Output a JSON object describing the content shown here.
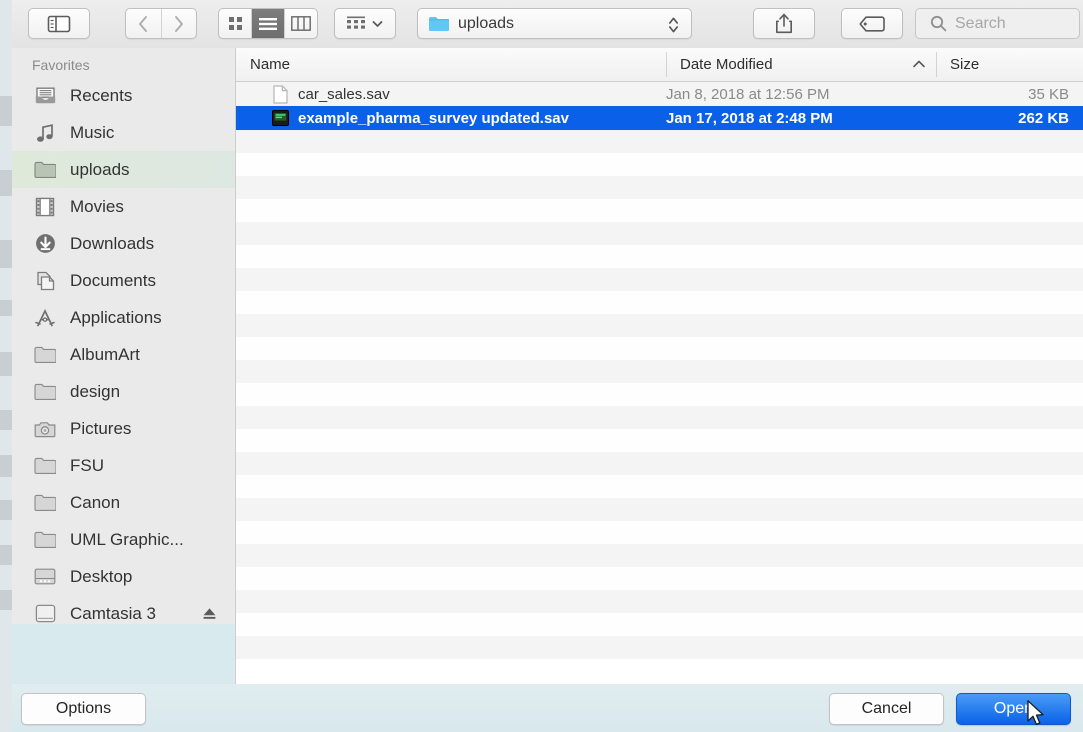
{
  "toolbar": {
    "sidebar_toggle_icon": "sidebar-toggle-icon",
    "back_icon": "chevron-left-icon",
    "forward_icon": "chevron-right-icon",
    "view_icon_grid": "grid-view-icon",
    "view_icon_list": "list-view-icon",
    "view_icon_column": "column-view-icon",
    "arrange_icon": "arrange-by-icon",
    "arrange_chevron": "chevron-down-icon",
    "path_label": "uploads",
    "path_folder_icon": "folder-icon",
    "path_stepper_icon": "chevron-up-down-icon",
    "share_icon": "share-icon",
    "tag_icon": "tag-icon",
    "search_icon": "search-icon",
    "search_placeholder": "Search",
    "search_value": ""
  },
  "sidebar": {
    "heading": "Favorites",
    "items": [
      {
        "label": "Recents",
        "icon": "recents-inbox-icon",
        "state": "normal"
      },
      {
        "label": "Music",
        "icon": "music-note-icon",
        "state": "normal"
      },
      {
        "label": "uploads",
        "icon": "folder-icon",
        "state": "selected"
      },
      {
        "label": "Movies",
        "icon": "film-strip-icon",
        "state": "normal"
      },
      {
        "label": "Downloads",
        "icon": "download-arrow-icon",
        "state": "normal"
      },
      {
        "label": "Documents",
        "icon": "documents-pages-icon",
        "state": "normal"
      },
      {
        "label": "Applications",
        "icon": "applications-a-icon",
        "state": "normal"
      },
      {
        "label": "AlbumArt",
        "icon": "folder-icon",
        "state": "normal"
      },
      {
        "label": "design",
        "icon": "folder-icon",
        "state": "normal"
      },
      {
        "label": "Pictures",
        "icon": "camera-icon",
        "state": "normal"
      },
      {
        "label": "FSU",
        "icon": "folder-icon",
        "state": "normal"
      },
      {
        "label": "Canon",
        "icon": "folder-icon",
        "state": "normal"
      },
      {
        "label": "UML Graphic...",
        "icon": "folder-icon",
        "state": "normal"
      },
      {
        "label": "Desktop",
        "icon": "desktop-icon",
        "state": "normal"
      },
      {
        "label": "Camtasia 3",
        "icon": "disk-volume-icon",
        "state": "normal",
        "eject_icon": "eject-icon"
      }
    ]
  },
  "filelist": {
    "columns": [
      {
        "label": "Name",
        "sort": ""
      },
      {
        "label": "Date Modified",
        "sort": "ascending",
        "sort_icon": "chevron-up-icon"
      },
      {
        "label": "Size",
        "sort": ""
      }
    ],
    "files": [
      {
        "name": "car_sales.sav",
        "date": "Jan 8, 2018 at 12:56 PM",
        "size": "35 KB",
        "icon": "blank-document-icon",
        "selected": false
      },
      {
        "name": "example_pharma_survey updated.sav",
        "date": "Jan 17, 2018 at 2:48 PM",
        "size": "262 KB",
        "icon": "spss-data-icon",
        "selected": true
      }
    ],
    "empty_row_count": 23
  },
  "bottombar": {
    "options_label": "Options",
    "cancel_label": "Cancel",
    "open_label": "Open",
    "cursor_icon": "mouse-pointer-icon"
  },
  "colors": {
    "selection_blue": "#0a60e8",
    "open_button_blue": "#1a74ef",
    "sidebar_bg": "#eaeaea",
    "toolbar_bg": "#e7e7e7",
    "bottom_bar_bg": "#dbeaee",
    "row_stripe": "#f4f4f4"
  }
}
